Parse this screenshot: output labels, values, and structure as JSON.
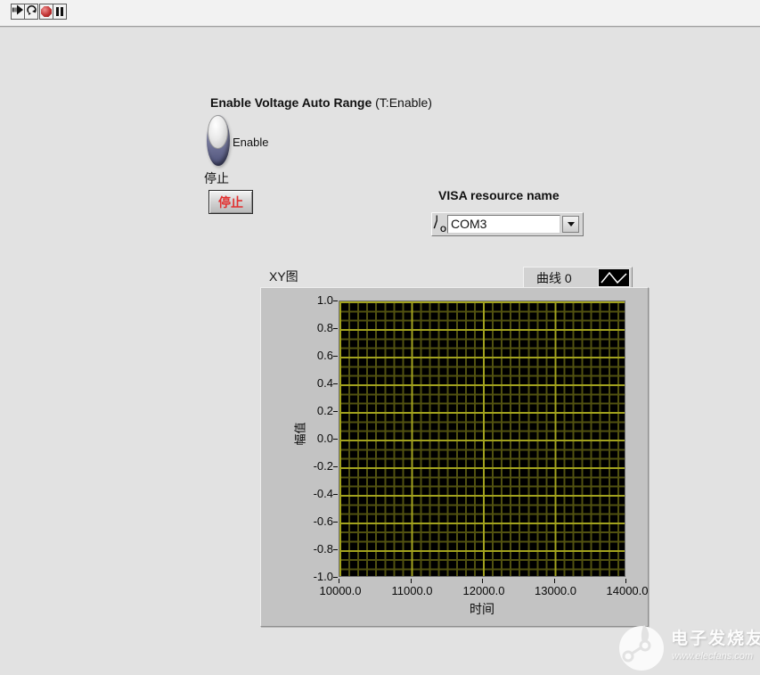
{
  "toolbar": {
    "buttons": [
      {
        "icon": "run-icon"
      },
      {
        "icon": "run-continuously-icon"
      },
      {
        "icon": "abort-icon"
      },
      {
        "icon": "pause-icon"
      }
    ]
  },
  "controls": {
    "auto_range": {
      "title_bold": "Enable Voltage Auto Range",
      "title_suffix": " (T:Enable)",
      "state_label": "Enable"
    },
    "stop": {
      "caption": "停止",
      "button_label": "停止"
    },
    "visa": {
      "label": "VISA resource name",
      "value": "COM3",
      "icon": "io-icon"
    }
  },
  "chart_data": {
    "type": "line",
    "title": "XY图",
    "xlabel": "时间",
    "ylabel": "幅值",
    "xlim": [
      10000.0,
      14000.0
    ],
    "ylim": [
      -1.0,
      1.0
    ],
    "x_ticks": [
      "10000.0",
      "11000.0",
      "12000.0",
      "13000.0",
      "14000.0"
    ],
    "y_ticks": [
      "1.0",
      "0.8",
      "0.6",
      "0.4",
      "0.2",
      "0.0",
      "-0.2",
      "-0.4",
      "-0.6",
      "-0.8",
      "-1.0"
    ],
    "grid": true,
    "legend_position": "top-right",
    "legend": [
      {
        "name": "曲线 0",
        "style": "line",
        "color": "#ffffff"
      }
    ],
    "series": [
      {
        "name": "曲线 0",
        "points": []
      }
    ],
    "plot_bg": "#000000",
    "grid_major_color": "#a2a21e",
    "grid_minor_color": "#515110"
  },
  "watermark": {
    "title": "电子发烧友",
    "url": "www.elecfans.com",
    "icon": "elecfans-logo-icon"
  }
}
